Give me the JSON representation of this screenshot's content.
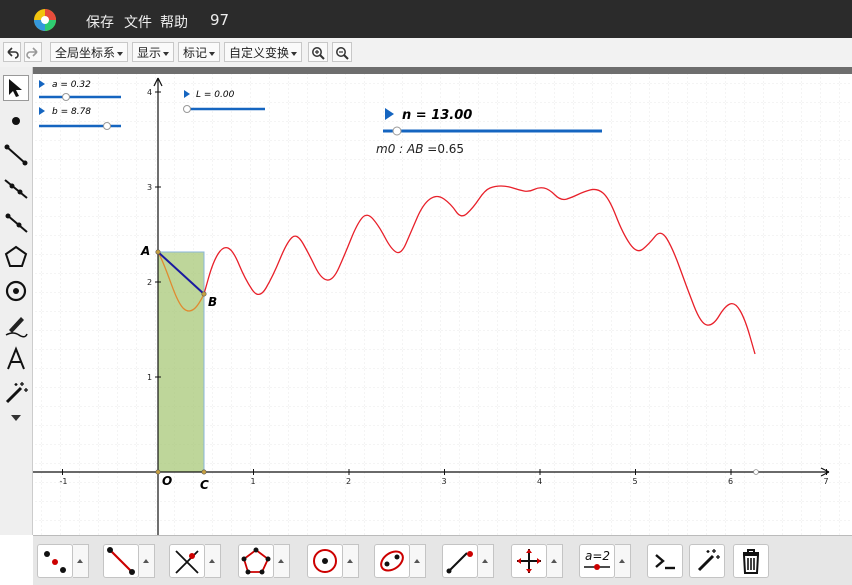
{
  "titlebar": {
    "menus": [
      "保存",
      "文件",
      "帮助"
    ],
    "number": "97"
  },
  "toolbar": {
    "undo_icon": "undo-icon",
    "redo_icon": "redo-icon",
    "buttons": [
      "全局坐标系",
      "显示",
      "标记",
      "自定义变换"
    ],
    "zoom_in_icon": "zoom-in-icon",
    "zoom_out_icon": "zoom-out-icon"
  },
  "sliders": {
    "a": "a = 0.32",
    "b": "b = 8.78",
    "L": "L = 0.00",
    "n": "n = 13.00"
  },
  "measure": {
    "prefix": "m0 : ",
    "name": "AB",
    "value": " =0.65"
  },
  "points": {
    "A": "A",
    "B": "B",
    "C": "C",
    "O": "O"
  },
  "axis": {
    "x_ticks": [
      "-1",
      "1",
      "2",
      "3",
      "4",
      "5",
      "6",
      "7"
    ],
    "y_ticks": [
      "1",
      "2",
      "3",
      "4"
    ]
  },
  "colors": {
    "curve": "#e8202a",
    "segment": "#1a1aa0",
    "rect_fill": "#a8c878",
    "slider": "#1565c0"
  }
}
